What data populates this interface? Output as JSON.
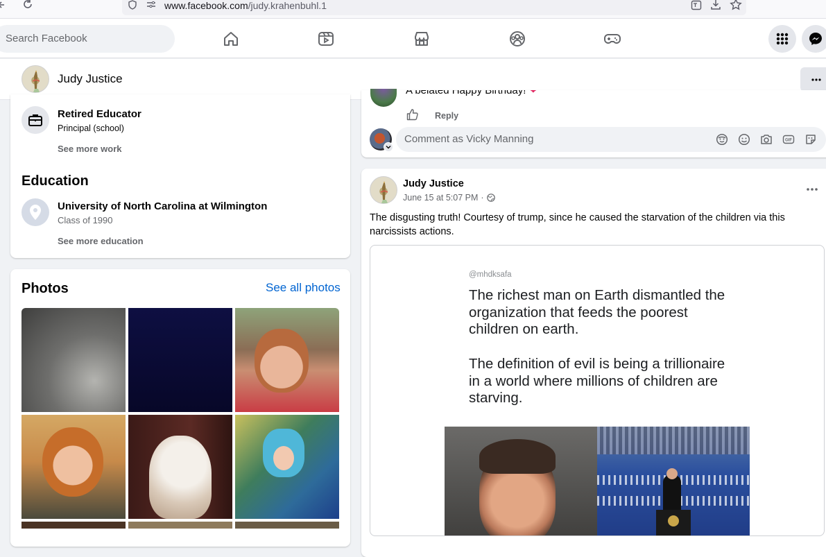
{
  "browser": {
    "url_domain": "www.facebook.com",
    "url_path": "/judy.krahenbuhl.1"
  },
  "header": {
    "search_placeholder": "Search Facebook",
    "nav_icons": [
      "home-icon",
      "video-icon",
      "marketplace-icon",
      "groups-icon",
      "gaming-icon"
    ],
    "right_icons": [
      "menu-grid-icon",
      "messenger-icon"
    ]
  },
  "profile_bar": {
    "name": "Judy Justice",
    "more_label": "···"
  },
  "about": {
    "work_title": "Retired Educator",
    "work_role": "Principal (school)",
    "see_more_work": "See more work",
    "education_heading": "Education",
    "school_name": "University of North Carolina at Wilmington",
    "school_class": "Class of 1990",
    "see_more_education": "See more education"
  },
  "photos": {
    "heading": "Photos",
    "see_all": "See all photos",
    "colors": [
      "#6e6e6c",
      "#0c0c3a",
      "#b98a6f",
      "#c88e4f",
      "#3b1a17",
      "#5a8fc0"
    ]
  },
  "comment_section": {
    "comment_text": "A belated Happy Birthday!",
    "reply_label": "Reply",
    "comment_placeholder": "Comment as Vicky Manning"
  },
  "post": {
    "author": "Judy Justice",
    "date": "June 15 at 5:07 PM",
    "separator": "·",
    "menu_label": "···",
    "text": "The disgusting truth! Courtesy of trump, since he caused the starvation of the children via this narcissists actions.",
    "image": {
      "handle": "@mhdksafa",
      "paragraph1": "The richest man on Earth dismantled the organization that feeds the poorest children on earth.",
      "paragraph2": "The definition of evil is being a trillionaire in a world where millions of children are starving."
    }
  }
}
